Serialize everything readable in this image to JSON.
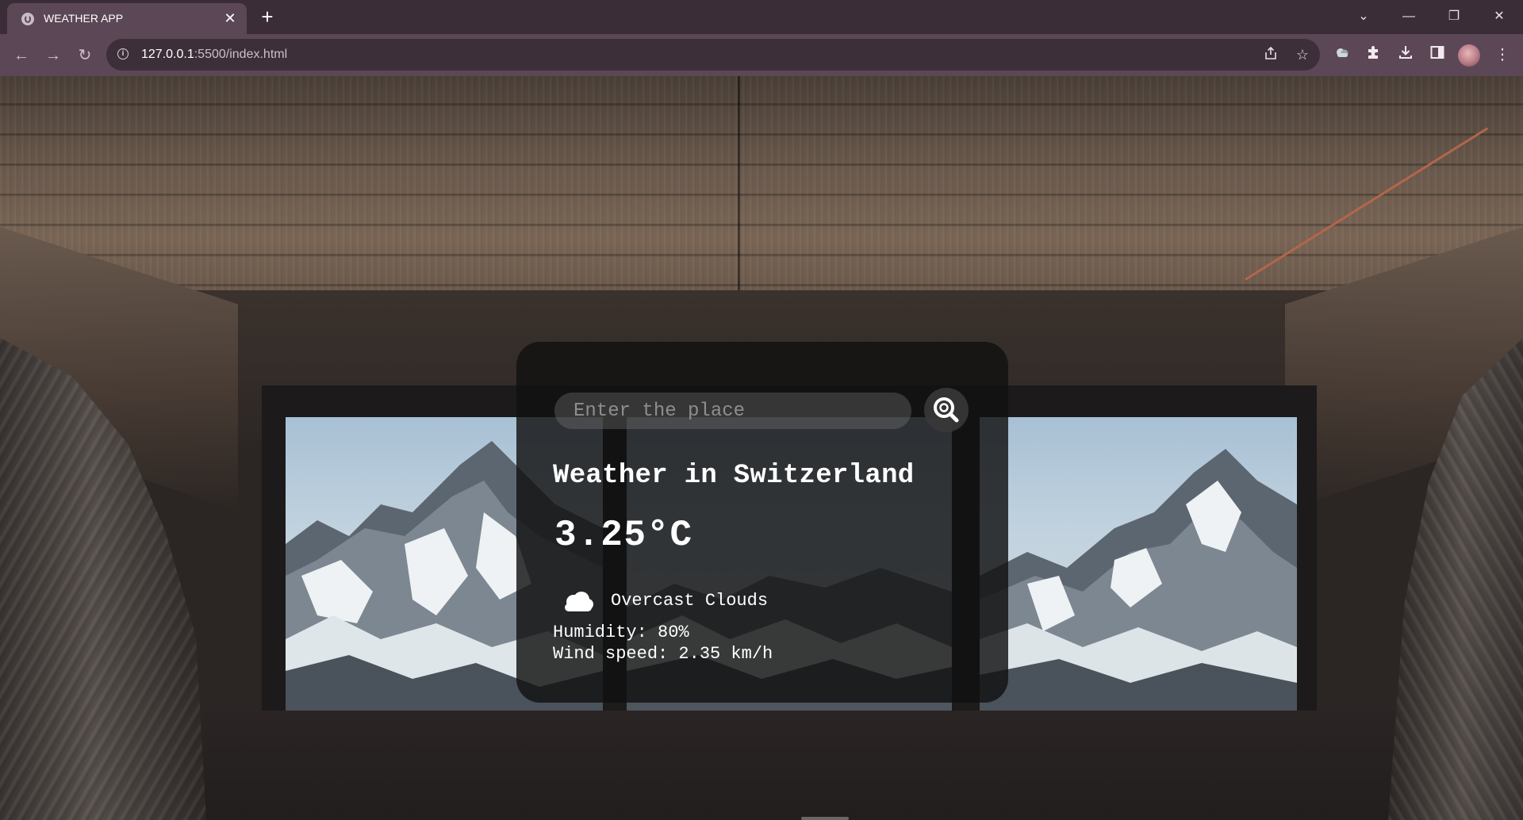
{
  "browser": {
    "tab_title": "WEATHER APP",
    "tab_close": "✕",
    "new_tab": "+",
    "url_host": "127.0.0.1",
    "url_rest": ":5500/index.html",
    "window_controls": {
      "dropdown": "⌄",
      "minimize": "—",
      "restore": "❐",
      "close": "✕"
    },
    "nav": {
      "back": "←",
      "forward": "→",
      "reload": "↻"
    },
    "icons": [
      "share-icon",
      "bookmark-star-icon",
      "weather-extension-icon",
      "extensions-puzzle-icon",
      "download-icon",
      "side-panel-icon",
      "profile-avatar",
      "more-menu-icon"
    ]
  },
  "weather": {
    "search_placeholder": "Enter the place",
    "search_value": "",
    "title": "Weather in Switzerland",
    "temperature": "3.25°C",
    "description": "Overcast Clouds",
    "humidity": "Humidity: 80%",
    "wind": "Wind speed: 2.35 km/h",
    "icon": "cloud-icon"
  },
  "colors": {
    "chrome_dark": "#3b2d37",
    "chrome_toolbar": "#5c4756",
    "card_bg": "rgba(17,17,17,0.82)"
  }
}
